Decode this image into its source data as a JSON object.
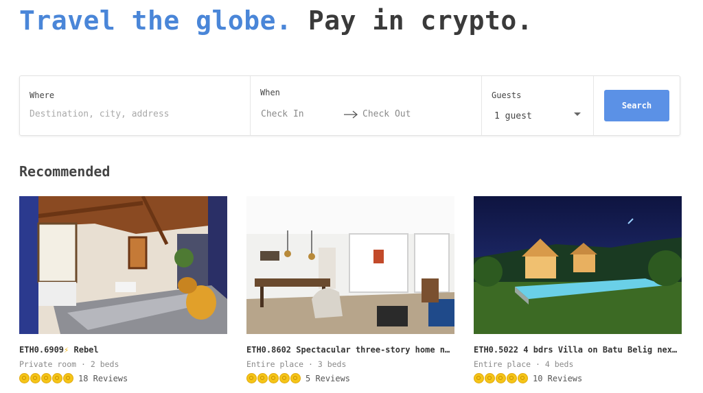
{
  "hero": {
    "highlight": "Travel the globe.",
    "rest": " Pay in crypto."
  },
  "search": {
    "where_label": "Where",
    "where_placeholder": "Destination, city, address",
    "when_label": "When",
    "check_in": "Check In",
    "check_out": "Check Out",
    "guests_label": "Guests",
    "guests_value": "1 guest",
    "button_label": "Search"
  },
  "recommended": {
    "title": "Recommended",
    "listings": [
      {
        "price": "ETH0.6909",
        "bolt": "⚡",
        "name": "Rebel",
        "details": "Private room · 2 beds",
        "rating": 5,
        "reviews": "18 Reviews"
      },
      {
        "price": "ETH0.8602",
        "bolt": "",
        "name": "Spectacular three-story home ne…",
        "details": "Entire place · 3 beds",
        "rating": 5,
        "reviews": "5 Reviews"
      },
      {
        "price": "ETH0.5022",
        "bolt": "",
        "name": "4 bdrs Villa on Batu Belig next…",
        "details": "Entire place · 4 beds",
        "rating": 5,
        "reviews": "10 Reviews"
      }
    ]
  },
  "colors": {
    "accent": "#4a86d8",
    "button": "#5b91e6",
    "star": "#f5c518"
  },
  "icons": {
    "arrow": "arrow-right-icon",
    "caret": "caret-down-icon",
    "rating": "star-icon"
  }
}
